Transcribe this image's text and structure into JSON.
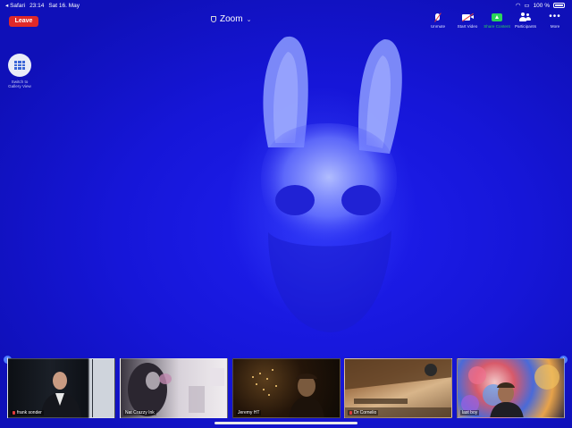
{
  "status_bar": {
    "back_app": "◂ Safari",
    "time": "23:14",
    "date": "Sat 16. May",
    "battery": "100 %"
  },
  "toolbar": {
    "leave_label": "Leave",
    "meeting_title": "Zoom",
    "items": [
      {
        "label": "Unmute",
        "icon": "mic-muted-icon"
      },
      {
        "label": "Start Video",
        "icon": "video-off-icon"
      },
      {
        "label": "Share Content",
        "icon": "share-screen-icon",
        "color": "#2bd45a"
      },
      {
        "label": "Participants",
        "icon": "participants-icon"
      },
      {
        "label": "More",
        "icon": "more-icon"
      }
    ]
  },
  "gallery_switch": {
    "label_line1": "Switch to",
    "label_line2": "Gallery View"
  },
  "thumbnails": [
    {
      "name": "frank sonder",
      "muted": true
    },
    {
      "name": "Nat Crazzy Ink",
      "muted": false
    },
    {
      "name": "Jeremy HT",
      "muted": false
    },
    {
      "name": "Dr Cornelio",
      "muted": true
    },
    {
      "name": "last boy",
      "muted": false
    }
  ],
  "colors": {
    "background": "#1616d8",
    "leave": "#e02929",
    "share": "#2bd45a"
  }
}
